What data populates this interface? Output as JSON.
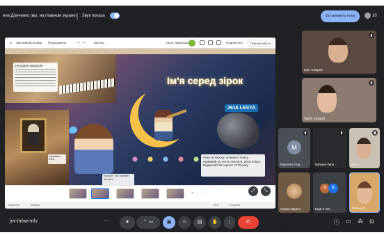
{
  "topbar": {
    "presenter": "ена Донченко (вы, на главном экране)",
    "sound_label": "Звук показа",
    "stop_button": "Остановить пока",
    "people_count": "10"
  },
  "editor": {
    "back_label": "Звичайний розмір",
    "edit_label": "Редагування",
    "view_label": "Вигляд",
    "language": "Лиза Українська",
    "share_label": "Поділитися",
    "present_label": "Презентувати"
  },
  "slide": {
    "title": "Ім'я серед зірок",
    "badge": "2616 LESYA",
    "info_title": "Незгідна симфонія",
    "caption_small": "Справжня Леся",
    "quote": "Більше, ніж портрет на стіні",
    "fact": "Існує астероїд головного поясу, названий на честь поетеси: 2616 Lesya. Відкритий 28 серпня 1970 року."
  },
  "status": {
    "notes": "Примітки",
    "timer": "Таймер",
    "zoom": "92%",
    "pages": "Сторінка"
  },
  "participants": [
    {
      "name": "Іван Тохарев"
    },
    {
      "name": "Vadim ShaqalII"
    },
    {
      "name": "Марьяна Сид...",
      "initial": "М"
    },
    {
      "name": "Михаил пере..."
    },
    {
      "name": "Анто..."
    },
    {
      "name": "Саша Гаврил..."
    },
    {
      "name": "Ещё 2 чел.",
      "initials": [
        "Я",
        "К"
      ]
    },
    {
      "name": "Олена Д..."
    }
  ],
  "bottombar": {
    "meet_code": "jvv-hrbw-mfs",
    "more_label": "···"
  },
  "colors": {
    "accent": "#8ab4f8",
    "end_call": "#ea4335",
    "dark": "#202124"
  }
}
